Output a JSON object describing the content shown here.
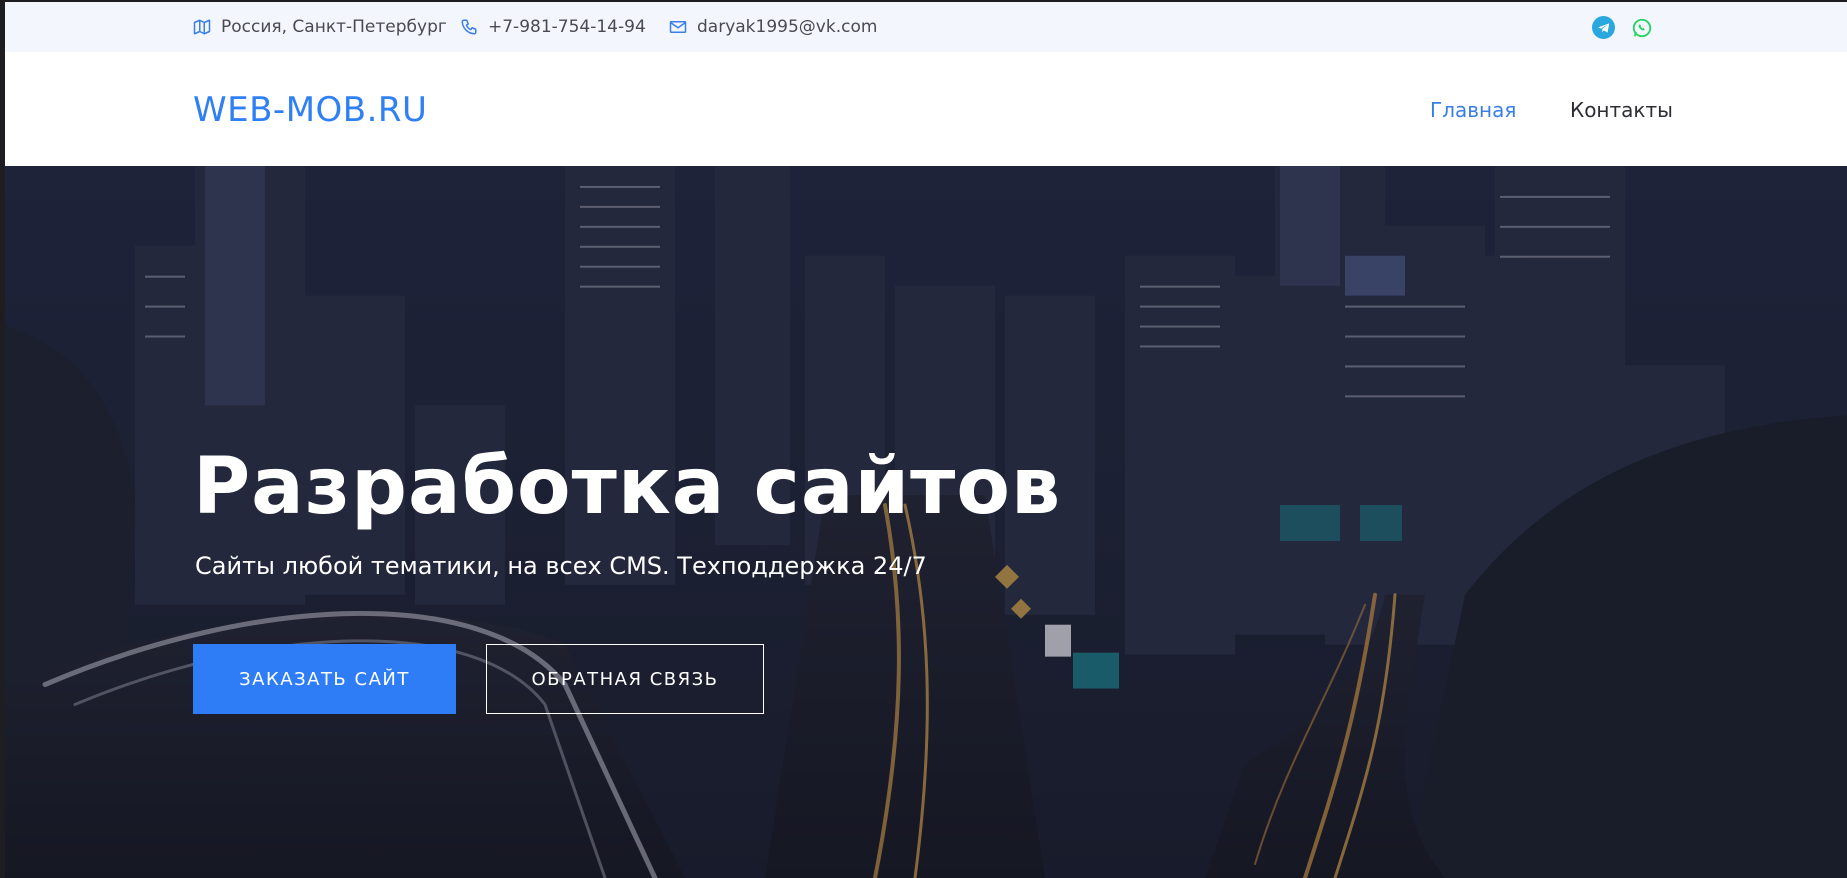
{
  "topbar": {
    "location": "Россия, Санкт-Петербург",
    "phone": "+7-981-754-14-94",
    "email": "daryak1995@vk.com",
    "icons": [
      "map-icon",
      "phone-icon",
      "mail-icon",
      "telegram-icon",
      "whatsapp-icon"
    ]
  },
  "header": {
    "logo": "WEB-MOB.RU",
    "nav": [
      {
        "label": "Главная",
        "active": true
      },
      {
        "label": "Контакты",
        "active": false
      }
    ]
  },
  "hero": {
    "title": "Разработка сайтов",
    "subtitle": "Сайты любой тематики, на всех CMS. Техподдержка 24/7",
    "primary_button": "ЗАКАЗАТЬ САЙТ",
    "secondary_button": "ОБРАТНАЯ СВЯЗЬ"
  },
  "colors": {
    "accent": "#2e7df7",
    "topbar_bg": "#f4f6fd",
    "hero_overlay": "#1c2033",
    "telegram": "#2aa7de",
    "whatsapp": "#25d366"
  }
}
